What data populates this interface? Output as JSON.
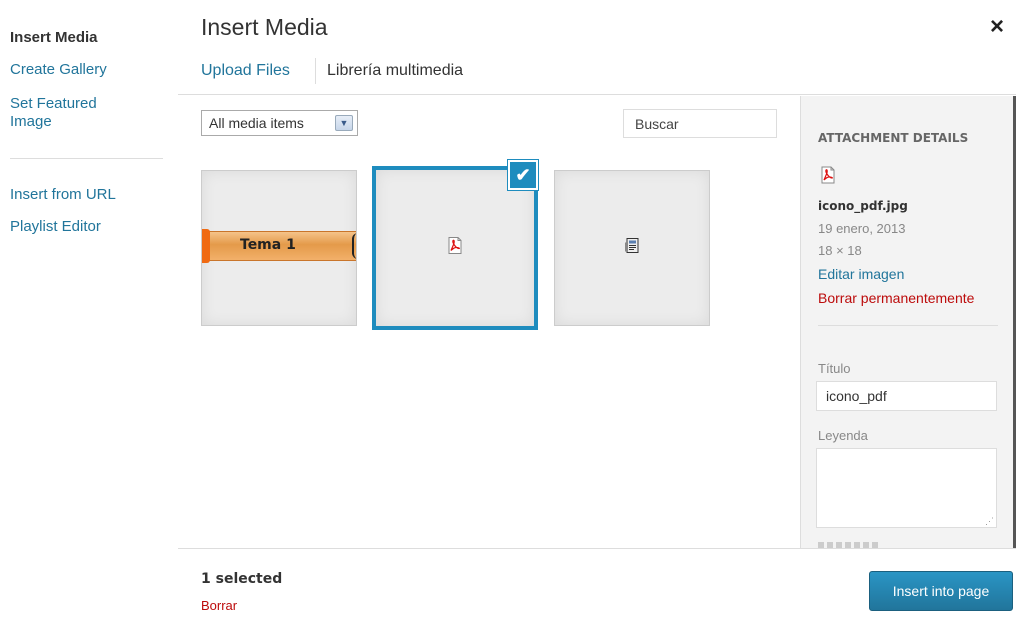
{
  "left_menu": {
    "items": [
      {
        "label": "Insert Media"
      },
      {
        "label": "Create Gallery"
      },
      {
        "label": "Set Featured"
      },
      {
        "label": "Image"
      },
      {
        "label": "Insert from URL"
      },
      {
        "label": "Playlist Editor"
      }
    ]
  },
  "header": {
    "title": "Insert Media",
    "close_symbol": "×"
  },
  "router": {
    "tabs": [
      {
        "label": "Upload Files"
      },
      {
        "label": "Librería multimedia"
      }
    ],
    "active_tab": "Librería multimedia"
  },
  "filters": {
    "media_filter_value": "All media items",
    "search_placeholder": "Buscar"
  },
  "attachments": [
    {
      "icon": "tema-1-image",
      "label": "Tema 1"
    },
    {
      "icon": "pdf-icon",
      "selected": true,
      "check_symbol": "✔"
    },
    {
      "icon": "document-icon"
    }
  ],
  "sidebar": {
    "heading": "ATTACHMENT DETAILS",
    "thumb_icon": "pdf-icon",
    "filename": "icono_pdf.jpg",
    "date": "19 enero, 2013",
    "dimensions": "18 × 18",
    "edit_link": "Editar imagen",
    "delete_link": "Borrar permanentemente",
    "title_label": "Título",
    "title_value": "icono_pdf",
    "caption_label": "Leyenda",
    "caption_value": ""
  },
  "toolbar": {
    "selected_count": "1 selected",
    "clear_link": "Borrar",
    "insert_button": "Insert into page"
  },
  "colors": {
    "link": "#21759b",
    "delete": "#bc0b0b",
    "selection_border": "#1e8cbe",
    "primary_button": "#21759b"
  }
}
